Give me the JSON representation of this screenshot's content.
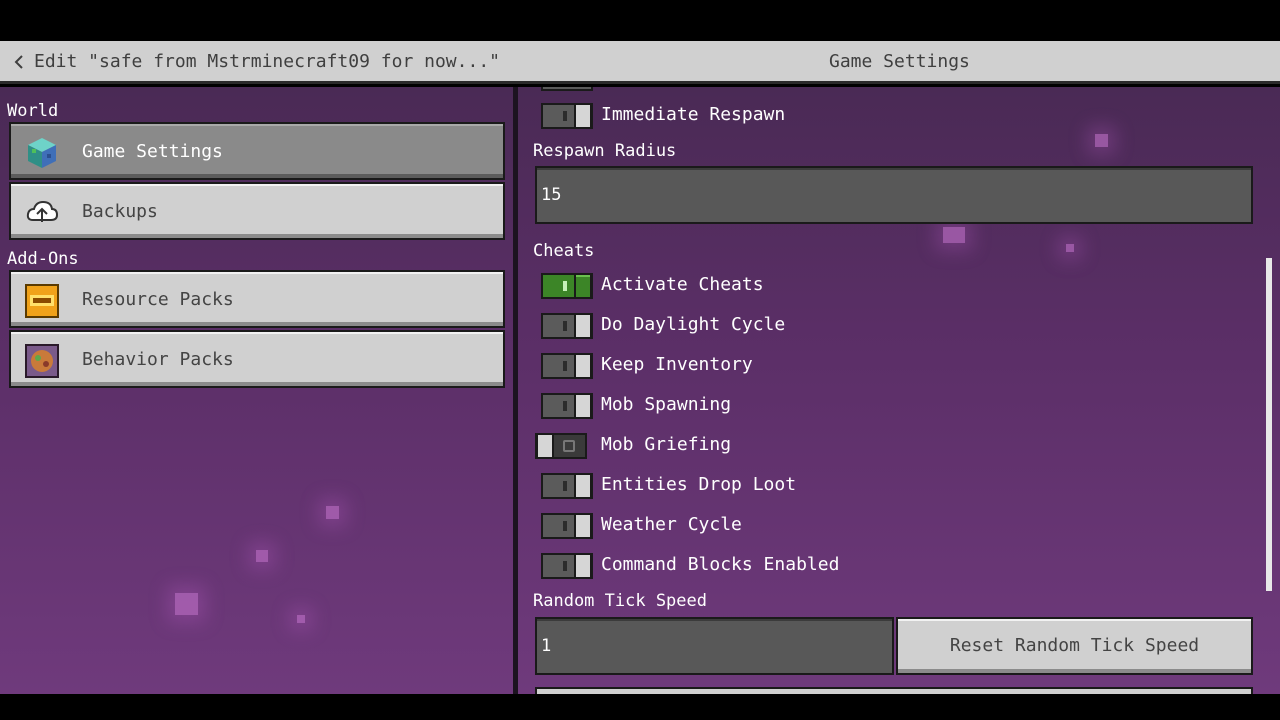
{
  "header": {
    "back_label": "Edit \"safe from Mstrminecraft09 for now...\"",
    "title": "Game Settings"
  },
  "sidebar": {
    "world_label": "World",
    "addons_label": "Add-Ons",
    "items": [
      {
        "label": "Game Settings",
        "icon": "world-cube-icon",
        "selected": true
      },
      {
        "label": "Backups",
        "icon": "cloud-upload-icon",
        "selected": false
      },
      {
        "label": "Resource Packs",
        "icon": "resource-pack-icon",
        "selected": false
      },
      {
        "label": "Behavior Packs",
        "icon": "behavior-pack-icon",
        "selected": false
      }
    ]
  },
  "settings": {
    "immediate_respawn": {
      "label": "Immediate Respawn",
      "on": false
    },
    "respawn_radius": {
      "label": "Respawn Radius",
      "value": "15"
    },
    "cheats_label": "Cheats",
    "toggles": [
      {
        "label": "Activate Cheats",
        "on": true
      },
      {
        "label": "Do Daylight Cycle",
        "on": false
      },
      {
        "label": "Keep Inventory",
        "on": false
      },
      {
        "label": "Mob Spawning",
        "on": false
      },
      {
        "label": "Mob Griefing",
        "on": false
      },
      {
        "label": "Entities Drop Loot",
        "on": false
      },
      {
        "label": "Weather Cycle",
        "on": false
      },
      {
        "label": "Command Blocks Enabled",
        "on": false
      }
    ],
    "random_tick_speed": {
      "label": "Random Tick Speed",
      "value": "1",
      "reset_label": "Reset Random Tick Speed"
    }
  },
  "colors": {
    "toggle_on": "#3c8527",
    "background_top": "#4a2a55",
    "background_bottom": "#6f3a7c",
    "button": "#d0d0d0"
  }
}
